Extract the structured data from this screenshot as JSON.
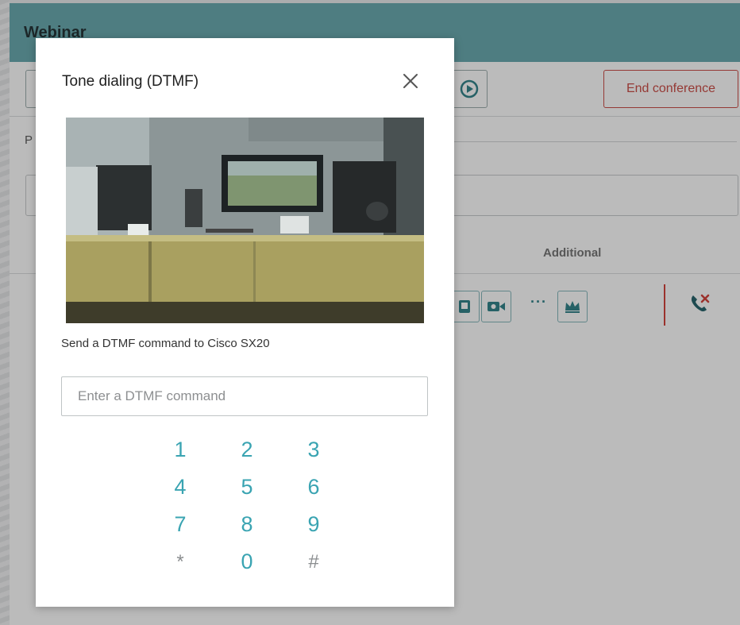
{
  "background": {
    "title": "Webinar",
    "end_conference_label": "End conference",
    "participants_label_partial": "P",
    "additional_label": "Additional",
    "colors": {
      "header": "#64a7ac",
      "danger": "#c9463f",
      "accent": "#3aa4b2"
    }
  },
  "modal": {
    "title": "Tone dialing (DTMF)",
    "close_icon": "close-icon",
    "description": "Send a DTMF command to Cisco SX20",
    "input_placeholder": "Enter a DTMF command",
    "input_value": "",
    "keypad": {
      "rows": [
        [
          "1",
          "2",
          "3"
        ],
        [
          "4",
          "5",
          "6"
        ],
        [
          "7",
          "8",
          "9"
        ],
        [
          "*",
          "0",
          "#"
        ]
      ]
    }
  }
}
